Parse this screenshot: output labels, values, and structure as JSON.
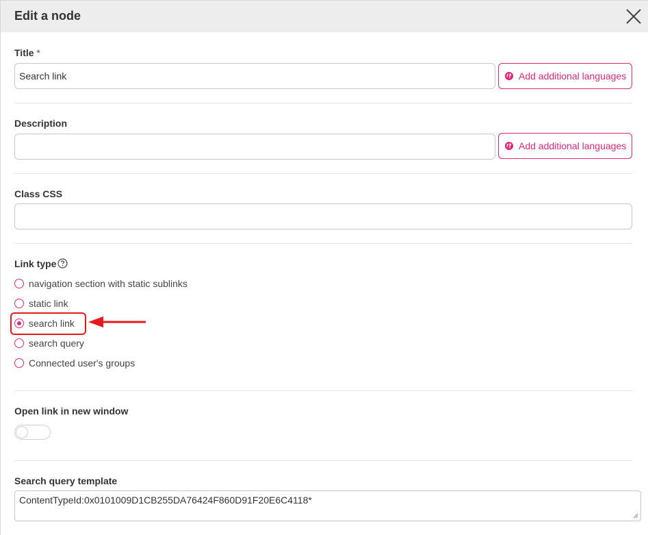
{
  "dialog": {
    "title": "Edit a node"
  },
  "title_field": {
    "label": "Title",
    "required_mark": "*",
    "value": "Search link",
    "lang_button": "Add additional languages"
  },
  "description_field": {
    "label": "Description",
    "value": "",
    "lang_button": "Add additional languages"
  },
  "class_css_field": {
    "label": "Class CSS",
    "value": ""
  },
  "link_type": {
    "label": "Link type",
    "options": [
      {
        "label": "navigation section with static sublinks",
        "selected": false
      },
      {
        "label": "static link",
        "selected": false
      },
      {
        "label": "search link",
        "selected": true
      },
      {
        "label": "search query",
        "selected": false
      },
      {
        "label": "Connected user's groups",
        "selected": false
      }
    ]
  },
  "open_new_window": {
    "label": "Open link in new window",
    "enabled": false
  },
  "search_query_template": {
    "label": "Search query template",
    "value": "ContentTypeId:0x0101009D1CB255DA76424F860D91F20E6C4118*"
  },
  "colors": {
    "accent": "#e0287a",
    "header_bg": "#ededed",
    "annotation": "#e8191c"
  },
  "icons": {
    "close": "close-icon",
    "globe": "globe-icon",
    "help": "help-circle-icon"
  }
}
